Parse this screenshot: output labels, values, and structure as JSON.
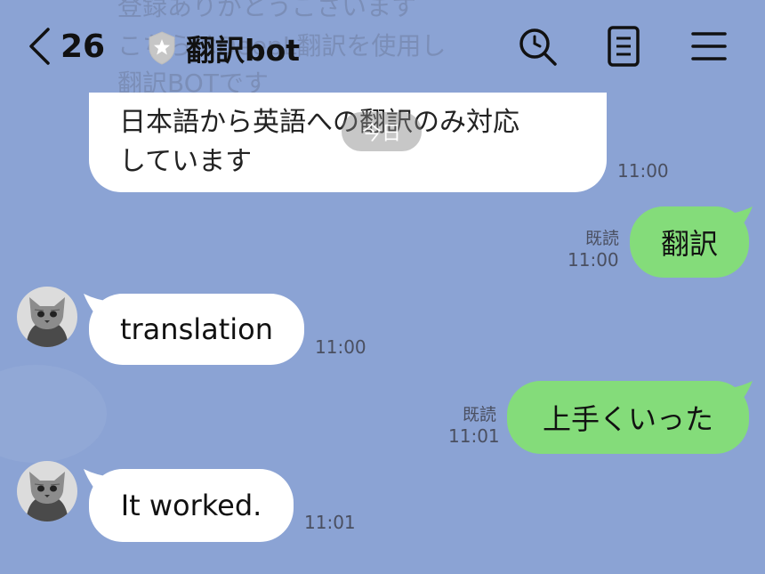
{
  "header": {
    "back_count": "26",
    "title": "翻訳bot",
    "search_icon": "search-icon",
    "notes_icon": "notes-icon",
    "menu_icon": "menu-icon"
  },
  "faded_preview": {
    "line1": "登録ありがとうございます",
    "line2": "こちらはDeepL翻訳を使用し",
    "line3": "翻訳BOTです"
  },
  "top_card": {
    "line1": "日本語から英語への翻訳のみ対応",
    "line2": "しています",
    "overlay_label": "今日",
    "time": "11:00"
  },
  "messages": [
    {
      "side": "right",
      "text": "翻訳",
      "read": "既読",
      "time": "11:00"
    },
    {
      "side": "left",
      "text": "translation",
      "time": "11:00"
    },
    {
      "side": "right",
      "text": "上手くいった",
      "read": "既読",
      "time": "11:01"
    },
    {
      "side": "left",
      "text": "It worked.",
      "time": "11:01"
    }
  ],
  "colors": {
    "background": "#8ba3d4",
    "sent_bubble": "#84dc7a",
    "received_bubble": "#ffffff"
  }
}
